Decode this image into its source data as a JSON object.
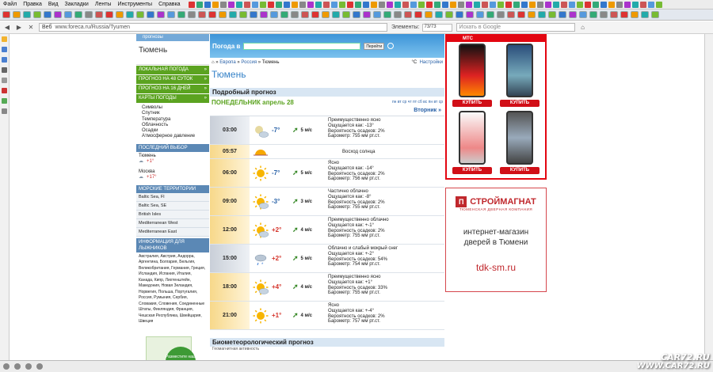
{
  "menu": [
    "Файл",
    "Правка",
    "Вид",
    "Закладки",
    "Ленты",
    "Инструменты",
    "Справка"
  ],
  "nav": {
    "site_label": "Веб",
    "url": "www.foreca.ru/Russia/Tyumen",
    "find_label": "Элементы:",
    "find_value": "73/73",
    "search_placeholder": "Искать в Google"
  },
  "watermark": {
    "line1": "CAR72.RU",
    "line2": "WWW.CAR72.RU"
  },
  "left": {
    "topstrip": "прогнозы",
    "city": "Тюмень",
    "buttons": [
      "ЛОКАЛЬНАЯ ПОГОДА",
      "ПРОГНОЗ НА 48 СУТОК",
      "ПРОГНОЗ НА 16 ДНЕЙ",
      "КАРТЫ ПОГОДЫ"
    ],
    "map_items": [
      "Символы",
      "Спутник",
      "Температура",
      "Облачность",
      "Осадки",
      "Атмосферное давление"
    ],
    "last_choice_header": "ПОСЛЕДНИЙ ВЫБОР",
    "last_cities": [
      {
        "name": "Тюмень",
        "temp": "+1°"
      },
      {
        "name": "Москва",
        "temp": "+17°"
      }
    ],
    "sea_header": "МОРСКИЕ ТЕРРИТОРИИ",
    "seas": [
      "Baltic Sea, FI",
      "Baltic Sea, SE",
      "British Isles",
      "Mediterranean West",
      "Mediterranean East"
    ],
    "ski_header": "ИНФОРМАЦИЯ ДЛЯ ЛЫЖНИКОВ",
    "ski_text": "Австралия, Австрия, Андорра, Аргентина, Болгария, Бельгия, Великобритания, Германия, Греция, Исландия, Испания, Италия, Канада, Кипр, Лихтенштейн, Македония, Новая Зеландия, Норвегия, Польша, Португалия, Россия, Румыния, Сербия, Словакия, Словения, Соединенные Штаты, Финляндия, Франция, Чешская Республика, Швейцария, Швеция",
    "promo_text": "Разместите наш прогноз на Вашем сайте!"
  },
  "main": {
    "search_label": "Погода в",
    "search_button": "Перейти",
    "breadcrumb": [
      "Европа",
      "Россия",
      "Тюмень"
    ],
    "units": "°C",
    "settings": "Настройки",
    "title": "Тюмень",
    "block_title": "Подробный прогноз",
    "day": "ПОНЕДЕЛЬНИК апрель 28",
    "day_links": "пн вт ср чт пт сб вс пн вт ср",
    "next_day": "Вторник »",
    "rows": [
      {
        "time": "03:00",
        "icon": "cloudy-night-icon",
        "temp": "-7°",
        "wind": "5 м/с",
        "lines": [
          "Преимущественно ясно",
          "Ощущается как: -13°",
          "Вероятность осадков: 2%",
          "Барометр: 755 мм рт.ст."
        ],
        "night": true
      },
      {
        "time": "05:57",
        "icon": "sunrise-icon",
        "sun": "Восход солнца"
      },
      {
        "time": "06:00",
        "icon": "sun-icon",
        "temp": "-7°",
        "wind": "5 м/с",
        "lines": [
          "Ясно",
          "Ощущается как: -14°",
          "Вероятность осадков: 2%",
          "Барометр: 756 мм рт.ст."
        ]
      },
      {
        "time": "09:00",
        "icon": "partly-cloudy-icon",
        "temp": "-3°",
        "wind": "3 м/с",
        "lines": [
          "Частично облачно",
          "Ощущается как: -8°",
          "Вероятность осадков: 2%",
          "Барометр: 755 мм рт.ст."
        ]
      },
      {
        "time": "12:00",
        "icon": "partly-cloudy-icon",
        "temp": "+2°",
        "wind": "4 м/с",
        "lines": [
          "Преимущественно облачно",
          "Ощущается как: +-1°",
          "Вероятность осадков: 2%",
          "Барометр: 755 мм рт.ст."
        ]
      },
      {
        "time": "15:00",
        "icon": "rain-snow-icon",
        "temp": "+2°",
        "wind": "5 м/с",
        "lines": [
          "Облачно и слабый мокрый снег",
          "Ощущается как: +-2°",
          "Вероятность осадков: 54%",
          "Барометр: 754 мм рт.ст."
        ],
        "night": true
      },
      {
        "time": "18:00",
        "icon": "partly-cloudy-icon",
        "temp": "+4°",
        "wind": "4 м/с",
        "lines": [
          "Преимущественно ясно",
          "Ощущается как: +1°",
          "Вероятность осадков: 33%",
          "Барометр: 755 мм рт.ст."
        ]
      },
      {
        "time": "21:00",
        "icon": "sun-icon",
        "temp": "+1°",
        "wind": "4 м/с",
        "lines": [
          "Ясно",
          "Ощущается как: +-4°",
          "Вероятность осадков: 2%",
          "Барометр: 757 мм рт.ст."
        ]
      }
    ],
    "bio_title": "Биометеорологический прогноз",
    "bio_line": "Геомагнитная активность"
  },
  "ads": {
    "mts": "МТС",
    "buy": "КУПИТЬ",
    "store_brand": "СТРОЙМАГНАТ",
    "store_sub": "ТЮМЕНСКАЯ ДВЕРНАЯ КОМПАНИЯ",
    "store_msg1": "интернет-магазин",
    "store_msg2": "дверей в Тюмени",
    "store_site": "tdk-sm.ru"
  }
}
